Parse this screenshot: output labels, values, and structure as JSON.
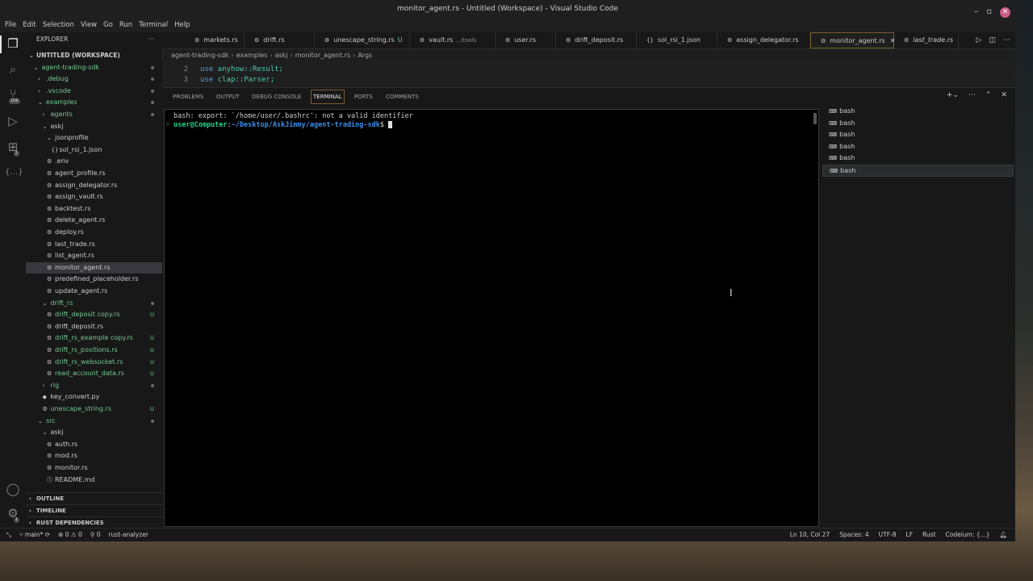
{
  "window": {
    "title": "monitor_agent.rs - Untitled (Workspace) - Visual Studio Code"
  },
  "menu": [
    "File",
    "Edit",
    "Selection",
    "View",
    "Go",
    "Run",
    "Terminal",
    "Help"
  ],
  "activity": {
    "notifications_badge": "10K",
    "extensions_badge": "2",
    "settings_badge": "1"
  },
  "explorer": {
    "title": "EXPLORER",
    "more": "···",
    "workspace": "UNTITLED (WORKSPACE)",
    "tree": [
      {
        "label": "agent-trading-sdk",
        "indent": 1,
        "chev": "⌄",
        "color": "#73c991",
        "status": "dot"
      },
      {
        "label": ".debug",
        "indent": 2,
        "chev": "›",
        "color": "#73c991",
        "status": "dot"
      },
      {
        "label": ".vscode",
        "indent": 2,
        "chev": "›",
        "color": "#73c991",
        "status": "dot"
      },
      {
        "label": "examples",
        "indent": 2,
        "chev": "⌄",
        "color": "#73c991",
        "status": "dot"
      },
      {
        "label": "agents",
        "indent": 3,
        "chev": "›",
        "color": "#73c991",
        "status": "dot"
      },
      {
        "label": "askj",
        "indent": 3,
        "chev": "⌄",
        "color": "#cccccc",
        "status": ""
      },
      {
        "label": "jsonprofile",
        "indent": 4,
        "chev": "⌄",
        "color": "#cccccc",
        "status": ""
      },
      {
        "label": "sol_rsi_1.json",
        "indent": 5,
        "icon": "{}",
        "color": "#cccccc",
        "status": ""
      },
      {
        "label": ".env",
        "indent": 4,
        "icon": "⚙",
        "color": "#cccccc",
        "status": ""
      },
      {
        "label": "agent_profile.rs",
        "indent": 4,
        "icon": "⚙",
        "color": "#cccccc",
        "status": ""
      },
      {
        "label": "assign_delegator.rs",
        "indent": 4,
        "icon": "⚙",
        "color": "#cccccc",
        "status": ""
      },
      {
        "label": "assign_vault.rs",
        "indent": 4,
        "icon": "⚙",
        "color": "#cccccc",
        "status": ""
      },
      {
        "label": "backtest.rs",
        "indent": 4,
        "icon": "⚙",
        "color": "#cccccc",
        "status": ""
      },
      {
        "label": "delete_agent.rs",
        "indent": 4,
        "icon": "⚙",
        "color": "#cccccc",
        "status": ""
      },
      {
        "label": "deploy.rs",
        "indent": 4,
        "icon": "⚙",
        "color": "#cccccc",
        "status": ""
      },
      {
        "label": "last_trade.rs",
        "indent": 4,
        "icon": "⚙",
        "color": "#cccccc",
        "status": ""
      },
      {
        "label": "list_agent.rs",
        "indent": 4,
        "icon": "⚙",
        "color": "#cccccc",
        "status": ""
      },
      {
        "label": "monitor_agent.rs",
        "indent": 4,
        "icon": "⚙",
        "color": "#cccccc",
        "status": "",
        "selected": true
      },
      {
        "label": "predefined_placeholder.rs",
        "indent": 4,
        "icon": "⚙",
        "color": "#cccccc",
        "status": ""
      },
      {
        "label": "update_agent.rs",
        "indent": 4,
        "icon": "⚙",
        "color": "#cccccc",
        "status": ""
      },
      {
        "label": "drift_rs",
        "indent": 3,
        "chev": "⌄",
        "color": "#73c991",
        "status": "dot"
      },
      {
        "label": "drift_deposit copy.rs",
        "indent": 4,
        "icon": "⚙",
        "color": "#73c991",
        "status": "U"
      },
      {
        "label": "drift_deposit.rs",
        "indent": 4,
        "icon": "⚙",
        "color": "#cccccc",
        "status": ""
      },
      {
        "label": "drift_rs_example copy.rs",
        "indent": 4,
        "icon": "⚙",
        "color": "#73c991",
        "status": "U"
      },
      {
        "label": "drift_rs_positions.rs",
        "indent": 4,
        "icon": "⚙",
        "color": "#73c991",
        "status": "U"
      },
      {
        "label": "drift_rs_websocket.rs",
        "indent": 4,
        "icon": "⚙",
        "color": "#73c991",
        "status": "U"
      },
      {
        "label": "read_account_data.rs",
        "indent": 4,
        "icon": "⚙",
        "color": "#73c991",
        "status": "U"
      },
      {
        "label": "rig",
        "indent": 3,
        "chev": "›",
        "color": "#73c991",
        "status": "dot"
      },
      {
        "label": "key_convert.py",
        "indent": 3,
        "icon": "◆",
        "color": "#cccccc",
        "status": ""
      },
      {
        "label": "unescape_string.rs",
        "indent": 3,
        "icon": "⚙",
        "color": "#73c991",
        "status": "U"
      },
      {
        "label": "src",
        "indent": 2,
        "chev": "⌄",
        "color": "#73c991",
        "status": "dot"
      },
      {
        "label": "askj",
        "indent": 3,
        "chev": "⌄",
        "color": "#cccccc",
        "status": ""
      },
      {
        "label": "auth.rs",
        "indent": 4,
        "icon": "⚙",
        "color": "#cccccc",
        "status": ""
      },
      {
        "label": "mod.rs",
        "indent": 4,
        "icon": "⚙",
        "color": "#cccccc",
        "status": ""
      },
      {
        "label": "monitor.rs",
        "indent": 4,
        "icon": "⚙",
        "color": "#cccccc",
        "status": ""
      },
      {
        "label": "README.md",
        "indent": 4,
        "icon": "ⓘ",
        "color": "#cccccc",
        "status": ""
      }
    ],
    "sections": [
      "OUTLINE",
      "TIMELINE",
      "RUST DEPENDENCIES"
    ]
  },
  "tabs": [
    {
      "label": "markets.rs",
      "icon": "⚙",
      "extra": "",
      "u": ""
    },
    {
      "label": "drift.rs",
      "icon": "⚙",
      "extra": "",
      "u": ""
    },
    {
      "label": "unescape_string.rs",
      "icon": "⚙",
      "extra": "",
      "u": "U"
    },
    {
      "label": "vault.rs",
      "icon": "⚙",
      "extra": ".../tools",
      "u": ""
    },
    {
      "label": "user.rs",
      "icon": "⚙",
      "extra": "",
      "u": ""
    },
    {
      "label": "drift_deposit.rs",
      "icon": "⚙",
      "extra": "",
      "u": ""
    },
    {
      "label": "sol_rsi_1.json",
      "icon": "{}",
      "extra": "",
      "u": ""
    },
    {
      "label": "assign_delegator.rs",
      "icon": "⚙",
      "extra": "",
      "u": ""
    },
    {
      "label": "monitor_agent.rs",
      "icon": "⚙",
      "extra": "",
      "u": "",
      "active": true
    },
    {
      "label": "last_trade.rs",
      "icon": "⚙",
      "extra": "",
      "u": ""
    }
  ],
  "breadcrumb": [
    "agent-trading-sdk",
    "examples",
    "askj",
    "monitor_agent.rs",
    "Args"
  ],
  "code": [
    {
      "ln": "2",
      "kw": "use",
      "rest": " anyhow::Result;"
    },
    {
      "ln": "3",
      "kw": "use",
      "rest": " clap::Parser;"
    }
  ],
  "panel": {
    "tabs": [
      "PROBLEMS",
      "OUTPUT",
      "DEBUG CONSOLE",
      "TERMINAL",
      "PORTS",
      "COMMENTS"
    ],
    "active_tab": "TERMINAL",
    "terminal": {
      "line1": "bash: export: `/home/user/.bashrc': not a valid identifier",
      "prompt_user": "user@Computer",
      "prompt_sep": ":",
      "prompt_path": "~/Desktop/AskJimmy/agent-trading-sdk",
      "prompt_end": "$"
    },
    "terminals": [
      "bash",
      "bash",
      "bash",
      "bash",
      "bash",
      "bash"
    ]
  },
  "status": {
    "branch": "main*",
    "errors": "0",
    "warnings": "0",
    "ports": "0",
    "analyzer": "rust-analyzer",
    "position": "Ln 10, Col 27",
    "spaces": "Spaces: 4",
    "encoding": "UTF-8",
    "eol": "LF",
    "language": "Rust",
    "codeium": "Codeium: {...}"
  }
}
